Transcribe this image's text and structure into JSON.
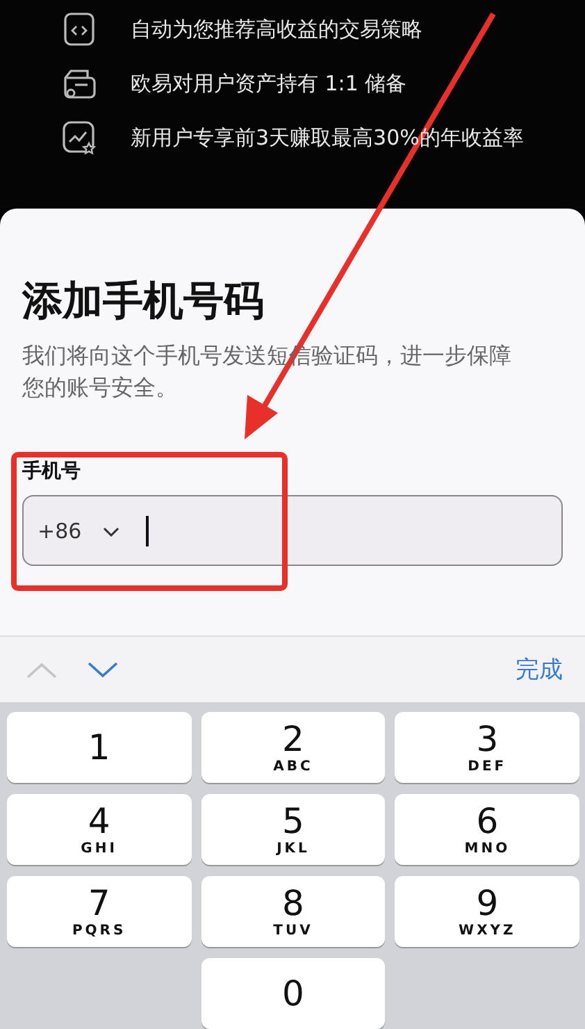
{
  "features": [
    {
      "text": "自动为您推荐高收益的交易策略"
    },
    {
      "text": "欧易对用户资产持有 1:1 储备"
    },
    {
      "text": "新用户专享前3天赚取最高30%的年收益率"
    }
  ],
  "sheet": {
    "title": "添加手机号码",
    "description": "我们将向这个手机号发送短信验证码，进一步保障您的账号安全。",
    "field": {
      "label": "手机号",
      "country_code": "+86",
      "focused": true
    }
  },
  "accessory_bar": {
    "previous": {
      "disabled": true
    },
    "next": {
      "disabled": false
    },
    "done": "完成"
  },
  "keypad": [
    {
      "digit": "1"
    },
    {
      "digit": "2",
      "letters": "ABC"
    },
    {
      "digit": "3",
      "letters": "DEF"
    },
    {
      "digit": "4",
      "letters": "GHI"
    },
    {
      "digit": "5",
      "letters": "JKL"
    },
    {
      "digit": "6",
      "letters": "MNO"
    },
    {
      "digit": "7",
      "letters": "PQRS"
    },
    {
      "digit": "8",
      "letters": "TUV"
    },
    {
      "digit": "9",
      "letters": "WXYZ"
    },
    {
      "digit": "0"
    }
  ],
  "annotations": {
    "arrow": true,
    "frame": true
  }
}
